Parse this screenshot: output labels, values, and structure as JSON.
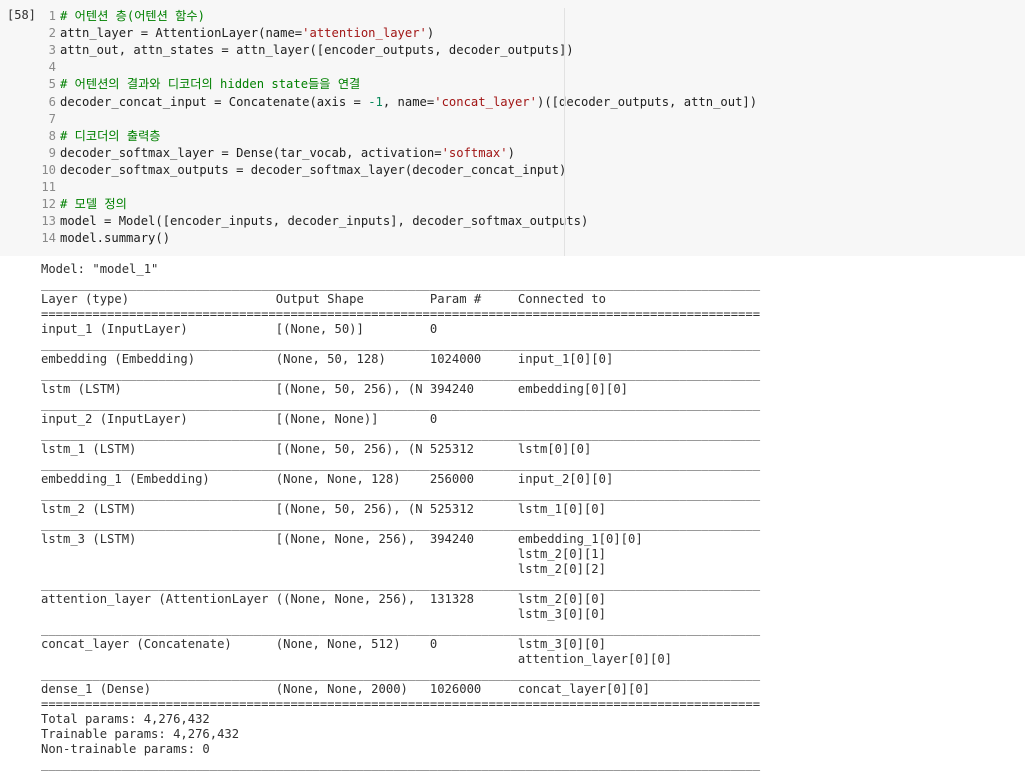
{
  "cell": {
    "execution_count": "[58]",
    "lines": [
      {
        "n": "1",
        "parts": [
          {
            "t": "# 어텐션 층(어텐션 함수)",
            "c": "cm"
          }
        ]
      },
      {
        "n": "2",
        "parts": [
          {
            "t": "attn_layer = AttentionLayer(name=",
            "c": ""
          },
          {
            "t": "'attention_layer'",
            "c": "st"
          },
          {
            "t": ")",
            "c": ""
          }
        ]
      },
      {
        "n": "3",
        "parts": [
          {
            "t": "attn_out, attn_states = attn_layer([encoder_outputs, decoder_outputs])",
            "c": ""
          }
        ]
      },
      {
        "n": "4",
        "parts": [
          {
            "t": "",
            "c": ""
          }
        ]
      },
      {
        "n": "5",
        "parts": [
          {
            "t": "# 어텐션의 결과와 디코더의 hidden state들을 연결",
            "c": "cm"
          }
        ]
      },
      {
        "n": "6",
        "parts": [
          {
            "t": "decoder_concat_input = Concatenate(axis = ",
            "c": ""
          },
          {
            "t": "-1",
            "c": "nu"
          },
          {
            "t": ", name=",
            "c": ""
          },
          {
            "t": "'concat_layer'",
            "c": "st"
          },
          {
            "t": ")([decoder_outputs, attn_out])",
            "c": ""
          }
        ]
      },
      {
        "n": "7",
        "parts": [
          {
            "t": "",
            "c": ""
          }
        ]
      },
      {
        "n": "8",
        "parts": [
          {
            "t": "# 디코더의 출력층",
            "c": "cm"
          }
        ]
      },
      {
        "n": "9",
        "parts": [
          {
            "t": "decoder_softmax_layer = Dense(tar_vocab, activation=",
            "c": ""
          },
          {
            "t": "'softmax'",
            "c": "st"
          },
          {
            "t": ")",
            "c": ""
          }
        ]
      },
      {
        "n": "10",
        "parts": [
          {
            "t": "decoder_softmax_outputs = decoder_softmax_layer(decoder_concat_input)",
            "c": ""
          }
        ]
      },
      {
        "n": "11",
        "parts": [
          {
            "t": "",
            "c": ""
          }
        ]
      },
      {
        "n": "12",
        "parts": [
          {
            "t": "# 모델 정의",
            "c": "cm"
          }
        ]
      },
      {
        "n": "13",
        "parts": [
          {
            "t": "model = Model([encoder_inputs, decoder_inputs], decoder_softmax_outputs)",
            "c": ""
          }
        ]
      },
      {
        "n": "14",
        "parts": [
          {
            "t": "model.summary()",
            "c": ""
          }
        ]
      }
    ]
  },
  "output": {
    "lines": [
      "Model: \"model_1\"",
      "__________________________________________________________________________________________________",
      "Layer (type)                    Output Shape         Param #     Connected to                     ",
      "==================================================================================================",
      "input_1 (InputLayer)            [(None, 50)]         0                                            ",
      "__________________________________________________________________________________________________",
      "embedding (Embedding)           (None, 50, 128)      1024000     input_1[0][0]                    ",
      "__________________________________________________________________________________________________",
      "lstm (LSTM)                     [(None, 50, 256), (N 394240      embedding[0][0]                  ",
      "__________________________________________________________________________________________________",
      "input_2 (InputLayer)            [(None, None)]       0                                            ",
      "__________________________________________________________________________________________________",
      "lstm_1 (LSTM)                   [(None, 50, 256), (N 525312      lstm[0][0]                       ",
      "__________________________________________________________________________________________________",
      "embedding_1 (Embedding)         (None, None, 128)    256000      input_2[0][0]                    ",
      "__________________________________________________________________________________________________",
      "lstm_2 (LSTM)                   [(None, 50, 256), (N 525312      lstm_1[0][0]                     ",
      "__________________________________________________________________________________________________",
      "lstm_3 (LSTM)                   [(None, None, 256),  394240      embedding_1[0][0]                ",
      "                                                                 lstm_2[0][1]                     ",
      "                                                                 lstm_2[0][2]                     ",
      "__________________________________________________________________________________________________",
      "attention_layer (AttentionLayer ((None, None, 256),  131328      lstm_2[0][0]                     ",
      "                                                                 lstm_3[0][0]                     ",
      "__________________________________________________________________________________________________",
      "concat_layer (Concatenate)      (None, None, 512)    0           lstm_3[0][0]                     ",
      "                                                                 attention_layer[0][0]            ",
      "__________________________________________________________________________________________________",
      "dense_1 (Dense)                 (None, None, 2000)   1026000     concat_layer[0][0]               ",
      "==================================================================================================",
      "Total params: 4,276,432",
      "Trainable params: 4,276,432",
      "Non-trainable params: 0",
      "__________________________________________________________________________________________________"
    ]
  }
}
